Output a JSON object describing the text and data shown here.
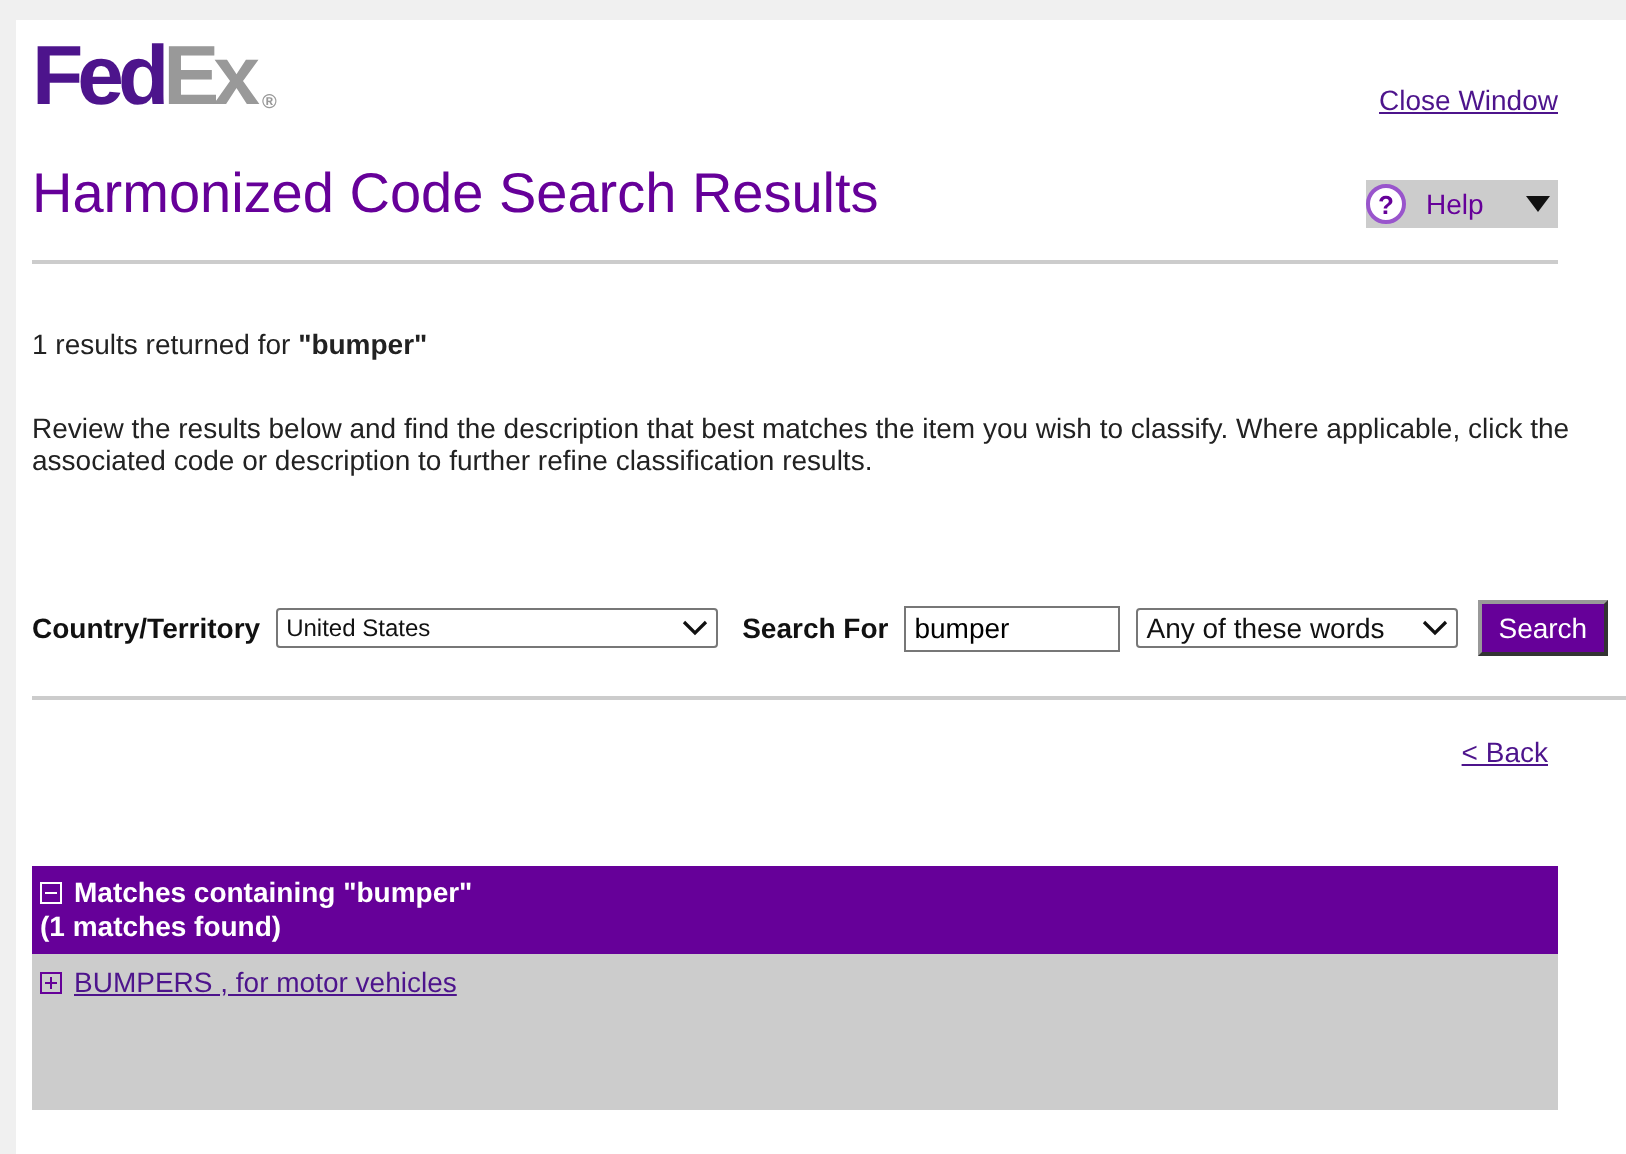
{
  "logo": {
    "first": "Fed",
    "second": "Ex",
    "mark": "®"
  },
  "close_link": "Close Window",
  "title": "Harmonized Code Search Results",
  "help": {
    "icon": "?",
    "label": "Help"
  },
  "summary": {
    "prefix": "1 results returned for ",
    "term": "\"bumper\""
  },
  "instructions": "Review the results below and find the description that best matches the item you wish to classify. Where applicable, click the associated code or description to further refine classification results.",
  "search": {
    "country_label": "Country/Territory",
    "country": "United States",
    "search_label": "Search For",
    "query": "bumper",
    "mode": "Any of these words",
    "button": "Search"
  },
  "back_link": "< Back",
  "results": {
    "heading": "Matches containing \"bumper\"",
    "count": "(1 matches found)",
    "expanded": true,
    "items": [
      {
        "label": "BUMPERS , for motor vehicles",
        "expanded": false
      }
    ]
  }
}
